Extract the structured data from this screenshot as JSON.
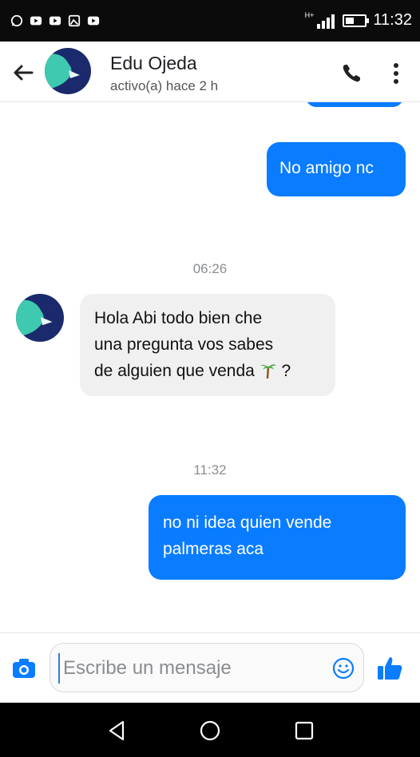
{
  "status_bar": {
    "time": "11:32",
    "network_label": "H+",
    "notification_icons": [
      "whatsapp-icon",
      "youtube-icon",
      "youtube-icon",
      "gallery-icon",
      "youtube-icon"
    ]
  },
  "header": {
    "contact_name": "Edu Ojeda",
    "contact_status": "activo(a) hace 2 h",
    "back_icon": "arrow-left-icon",
    "call_icon": "phone-icon",
    "more_icon": "more-vertical-icon"
  },
  "messages": [
    {
      "direction": "out",
      "text": "No amigo nc"
    },
    {
      "timestamp": "06:26"
    },
    {
      "direction": "in",
      "lines": [
        "Hola Abi todo bien che",
        "una pregunta vos sabes",
        "de alguien que venda"
      ],
      "emoji": "palm-tree-icon",
      "suffix": " ?"
    },
    {
      "timestamp": "11:32"
    },
    {
      "direction": "out",
      "lines": [
        "no ni idea quien vende",
        "palmeras aca"
      ]
    }
  ],
  "composer": {
    "placeholder": "Escribe un mensaje",
    "camera_icon": "camera-icon",
    "emoji_icon": "smiley-icon",
    "like_icon": "thumbs-up-icon"
  },
  "nav_bar": {
    "icons": [
      "back-triangle-icon",
      "home-circle-icon",
      "recents-square-icon"
    ]
  },
  "colors": {
    "accent": "#0a7cff",
    "incoming_bubble": "#f1f0f0",
    "timestamp": "#8a8d91",
    "status_bar_bg": "#0b0b0b"
  }
}
